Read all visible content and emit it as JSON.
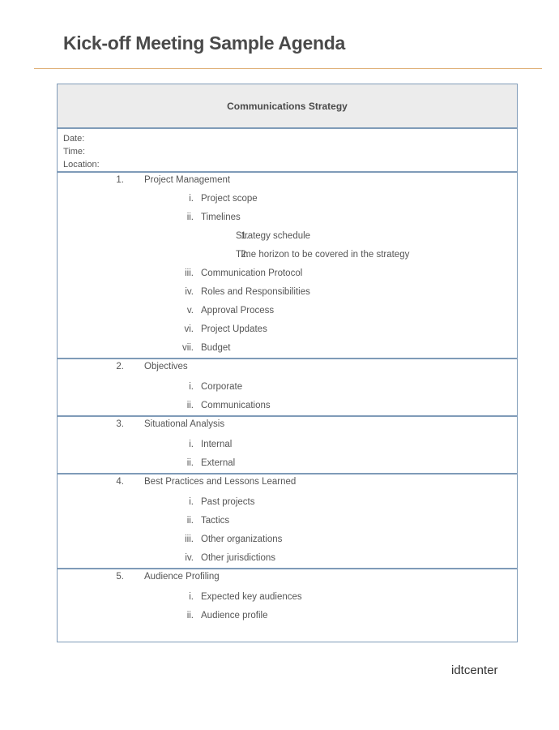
{
  "document": {
    "title": "Kick-off Meeting Sample Agenda",
    "table_header": "Communications Strategy",
    "meta": {
      "date_label": "Date:",
      "time_label": "Time:",
      "location_label": "Location:"
    },
    "sections": [
      {
        "num": "1.",
        "label": "Project Management",
        "items": [
          {
            "num": "i.",
            "label": "Project scope"
          },
          {
            "num": "ii.",
            "label": "Timelines",
            "sub": [
              {
                "num": "1.",
                "label": "Strategy schedule"
              },
              {
                "num": "2.",
                "label": "Time horizon to be covered in the strategy"
              }
            ]
          },
          {
            "num": "iii.",
            "label": "Communication Protocol"
          },
          {
            "num": "iv.",
            "label": "Roles and Responsibilities"
          },
          {
            "num": "v.",
            "label": "Approval Process"
          },
          {
            "num": "vi.",
            "label": "Project Updates"
          },
          {
            "num": "vii.",
            "label": "Budget"
          }
        ]
      },
      {
        "num": "2.",
        "label": "Objectives",
        "items": [
          {
            "num": "i.",
            "label": "Corporate"
          },
          {
            "num": "ii.",
            "label": "Communications"
          }
        ]
      },
      {
        "num": "3.",
        "label": "Situational Analysis",
        "items": [
          {
            "num": "i.",
            "label": "Internal"
          },
          {
            "num": "ii.",
            "label": "External"
          }
        ]
      },
      {
        "num": "4.",
        "label": "Best Practices and Lessons Learned",
        "items": [
          {
            "num": "i.",
            "label": "Past projects"
          },
          {
            "num": "ii.",
            "label": "Tactics"
          },
          {
            "num": "iii.",
            "label": "Other organizations"
          },
          {
            "num": "iv.",
            "label": "Other jurisdictions"
          }
        ]
      },
      {
        "num": "5.",
        "label": "Audience Profiling",
        "items": [
          {
            "num": "i.",
            "label": "Expected key audiences"
          },
          {
            "num": "ii.",
            "label": "Audience profile"
          }
        ]
      }
    ],
    "footer": "idtcenter"
  },
  "colors": {
    "rule": "#e0b27a",
    "table_border": "#7f9bb8",
    "header_bg": "#ececec"
  }
}
